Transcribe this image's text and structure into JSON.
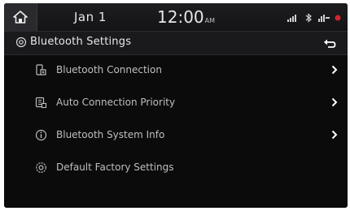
{
  "status_bar": {
    "date": "Jan  1",
    "time": "12:00",
    "ampm": "AM",
    "icons": [
      "cellular-signal-icon",
      "bluetooth-icon",
      "lte-icon",
      "alert-icon"
    ]
  },
  "header": {
    "title": "Bluetooth Settings",
    "icon": "gear-icon",
    "back_icon": "back-arrow-icon"
  },
  "menu": {
    "items": [
      {
        "label": "Bluetooth Connection",
        "icon": "phone-connection-icon",
        "has_chevron": true
      },
      {
        "label": "Auto Connection Priority",
        "icon": "priority-icon",
        "has_chevron": true
      },
      {
        "label": "Bluetooth System Info",
        "icon": "info-icon",
        "has_chevron": true
      },
      {
        "label": "Default Factory Settings",
        "icon": "reset-gear-icon",
        "has_chevron": false
      }
    ]
  },
  "colors": {
    "background": "#0b0b0c",
    "text": "#bfbfbf",
    "alert": "#d0242b"
  }
}
